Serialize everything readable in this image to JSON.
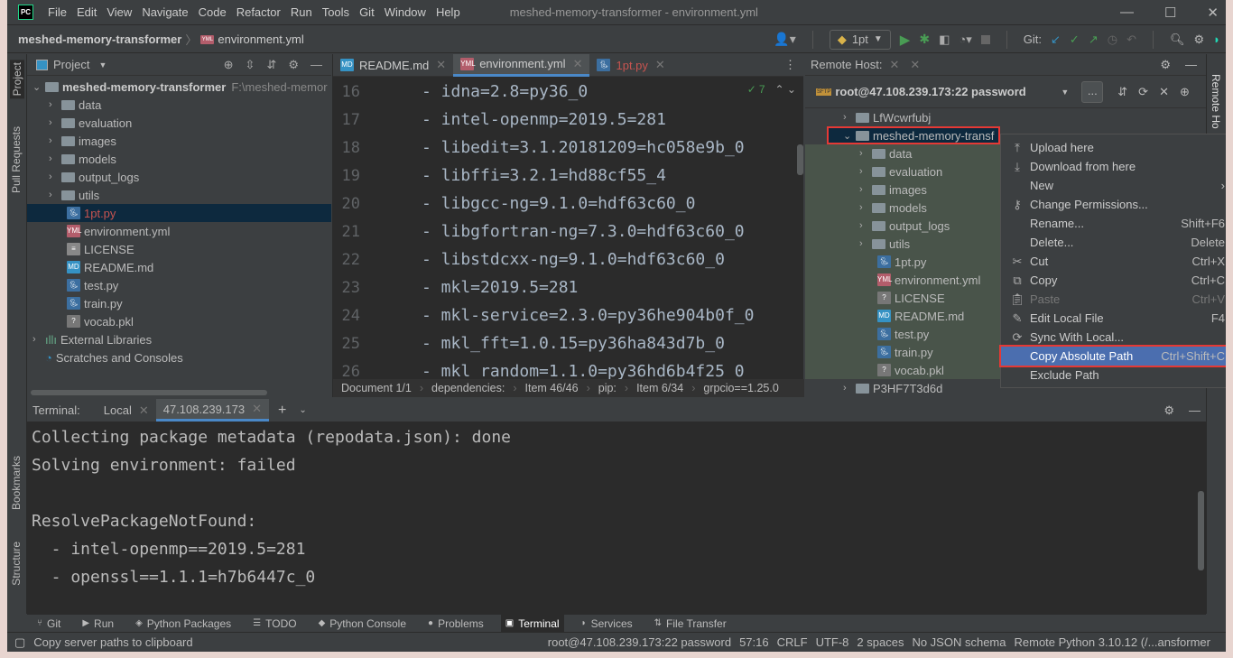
{
  "app": {
    "logo": "PC",
    "title": "meshed-memory-transformer - environment.yml"
  },
  "menu": [
    "File",
    "Edit",
    "View",
    "Navigate",
    "Code",
    "Refactor",
    "Run",
    "Tools",
    "Git",
    "Window",
    "Help"
  ],
  "breadcrumb": {
    "project": "meshed-memory-transformer",
    "file": "environment.yml"
  },
  "run_config": "1pt",
  "git_label": "Git:",
  "project_panel": {
    "title": "Project",
    "root": "meshed-memory-transformer",
    "root_path": "F:\\meshed-memor",
    "folders": [
      "data",
      "evaluation",
      "images",
      "models",
      "output_logs",
      "utils"
    ],
    "files": [
      {
        "name": "1pt.py",
        "type": "py"
      },
      {
        "name": "environment.yml",
        "type": "yml"
      },
      {
        "name": "LICENSE",
        "type": "txt"
      },
      {
        "name": "README.md",
        "type": "md"
      },
      {
        "name": "test.py",
        "type": "py"
      },
      {
        "name": "train.py",
        "type": "py"
      },
      {
        "name": "vocab.pkl",
        "type": "unknown"
      }
    ],
    "external": "External Libraries",
    "scratches": "Scratches and Consoles"
  },
  "editor": {
    "tabs": [
      "README.md",
      "environment.yml",
      "1pt.py"
    ],
    "active_tab": 1,
    "inspections": "7",
    "lines": [
      {
        "n": "16",
        "t": "- idna=2.8=py36_0"
      },
      {
        "n": "17",
        "t": "- intel-openmp=2019.5=281"
      },
      {
        "n": "18",
        "t": "- libedit=3.1.20181209=hc058e9b_0"
      },
      {
        "n": "19",
        "t": "- libffi=3.2.1=hd88cf55_4"
      },
      {
        "n": "20",
        "t": "- libgcc-ng=9.1.0=hdf63c60_0"
      },
      {
        "n": "21",
        "t": "- libgfortran-ng=7.3.0=hdf63c60_0"
      },
      {
        "n": "22",
        "t": "- libstdcxx-ng=9.1.0=hdf63c60_0"
      },
      {
        "n": "23",
        "t": "- mkl=2019.5=281"
      },
      {
        "n": "24",
        "t": "- mkl-service=2.3.0=py36he904b0f_0"
      },
      {
        "n": "25",
        "t": "- mkl_fft=1.0.15=py36ha843d7b_0"
      },
      {
        "n": "26",
        "t": "- mkl_random=1.1.0=py36hd6b4f25_0"
      }
    ],
    "crumbs": [
      "Document 1/1",
      "dependencies:",
      "Item 46/46",
      "pip:",
      "Item 6/34",
      "grpcio==1.25.0"
    ]
  },
  "remote": {
    "title": "Remote Host:",
    "host": "root@47.108.239.173:22 password",
    "more": "...",
    "top": "LfWcwrfubj",
    "selected": "meshed-memory-transf",
    "folders": [
      "data",
      "evaluation",
      "images",
      "models",
      "output_logs",
      "utils"
    ],
    "files": [
      {
        "name": "1pt.py",
        "type": "py"
      },
      {
        "name": "environment.yml",
        "type": "yml"
      },
      {
        "name": "LICENSE",
        "type": "unknown"
      },
      {
        "name": "README.md",
        "type": "md"
      },
      {
        "name": "test.py",
        "type": "py"
      },
      {
        "name": "train.py",
        "type": "py"
      },
      {
        "name": "vocab.pkl",
        "type": "unknown"
      }
    ],
    "bottom": "P3HF7T3d6d",
    "side_tab": "Remote Ho"
  },
  "context_menu": [
    {
      "label": "Upload here",
      "icon": "upload-icon",
      "sc": ""
    },
    {
      "label": "Download from here",
      "icon": "download-icon",
      "sc": ""
    },
    {
      "label": "New",
      "icon": "",
      "sc": "›"
    },
    {
      "label": "Change Permissions...",
      "icon": "key-icon",
      "sc": ""
    },
    {
      "label": "Rename...",
      "icon": "",
      "sc": "Shift+F6"
    },
    {
      "label": "Delete...",
      "icon": "",
      "sc": "Delete"
    },
    {
      "label": "Cut",
      "icon": "scissors-icon",
      "sc": "Ctrl+X"
    },
    {
      "label": "Copy",
      "icon": "copy-icon",
      "sc": "Ctrl+C"
    },
    {
      "label": "Paste",
      "icon": "paste-icon",
      "sc": "Ctrl+V",
      "disabled": true
    },
    {
      "label": "Edit Local File",
      "icon": "edit-icon",
      "sc": "F4"
    },
    {
      "label": "Sync With Local...",
      "icon": "sync-icon",
      "sc": ""
    },
    {
      "label": "Copy Absolute Path",
      "icon": "",
      "sc": "Ctrl+Shift+C",
      "selected": true
    },
    {
      "label": "Exclude Path",
      "icon": "",
      "sc": ""
    }
  ],
  "terminal": {
    "label": "Terminal:",
    "tabs": [
      "Local",
      "47.108.239.173"
    ],
    "active": 1,
    "lines": [
      "Collecting package metadata (repodata.json): done",
      "Solving environment: failed",
      "",
      "ResolvePackageNotFound:",
      "  - intel-openmp==2019.5=281",
      "  - openssl==1.1.1=h7b6447c_0"
    ]
  },
  "left_strip": [
    "Project",
    "Pull Requests",
    "Bookmarks",
    "Structure"
  ],
  "bottom_tabs": [
    "Git",
    "Run",
    "Python Packages",
    "TODO",
    "Python Console",
    "Problems",
    "Terminal",
    "Services",
    "File Transfer"
  ],
  "bottom_active": 6,
  "status": {
    "message": "Copy server paths to clipboard",
    "items": [
      "root@47.108.239.173:22 password",
      "57:16",
      "CRLF",
      "UTF-8",
      "2 spaces",
      "No JSON schema",
      "Remote Python 3.10.12 (/...ansformer"
    ]
  },
  "colors": {
    "accent": "#4b6eaf",
    "highlight_box": "#e53935",
    "error_file": "#c75450",
    "editor_bg": "#2b2b2b",
    "panel_bg": "#3c3f41",
    "remote_tree_bg": "#49544a"
  }
}
